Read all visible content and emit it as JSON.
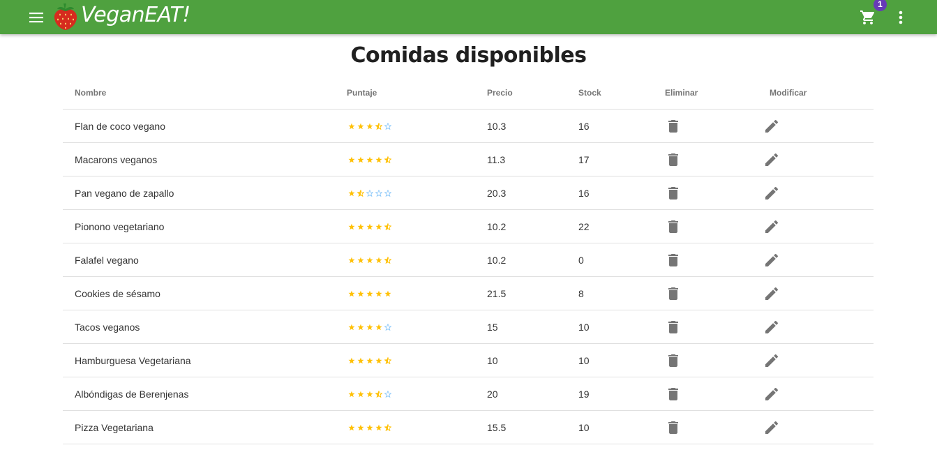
{
  "appbar": {
    "brand": "VeganEAT!",
    "cart_count": "1",
    "icons": [
      "menu-icon",
      "strawberry-logo",
      "cart-icon",
      "more-vert-icon"
    ],
    "background": "#4fa13f",
    "badge_color": "#673ab7"
  },
  "page": {
    "title": "Comidas disponibles"
  },
  "table": {
    "headers": {
      "name": "Nombre",
      "score": "Puntaje",
      "price": "Precio",
      "stock": "Stock",
      "delete": "Eliminar",
      "modify": "Modificar"
    },
    "star_colors": {
      "filled": "#ffc107",
      "empty": "#90caf9"
    },
    "rows": [
      {
        "name": "Flan de coco vegano",
        "rating": 3.5,
        "price": "10.3",
        "stock": "16"
      },
      {
        "name": "Macarons veganos",
        "rating": 4.5,
        "price": "11.3",
        "stock": "17"
      },
      {
        "name": "Pan vegano de zapallo",
        "rating": 1.5,
        "price": "20.3",
        "stock": "16"
      },
      {
        "name": "Pionono vegetariano",
        "rating": 4.5,
        "price": "10.2",
        "stock": "22"
      },
      {
        "name": "Falafel vegano",
        "rating": 4.5,
        "price": "10.2",
        "stock": "0"
      },
      {
        "name": "Cookies de sésamo",
        "rating": 5,
        "price": "21.5",
        "stock": "8"
      },
      {
        "name": "Tacos veganos",
        "rating": 4,
        "price": "15",
        "stock": "10"
      },
      {
        "name": "Hamburguesa Vegetariana",
        "rating": 4.5,
        "price": "10",
        "stock": "10"
      },
      {
        "name": "Albóndigas de Berenjenas",
        "rating": 3.5,
        "price": "20",
        "stock": "19"
      },
      {
        "name": "Pizza Vegetariana",
        "rating": 4.5,
        "price": "15.5",
        "stock": "10"
      }
    ]
  }
}
